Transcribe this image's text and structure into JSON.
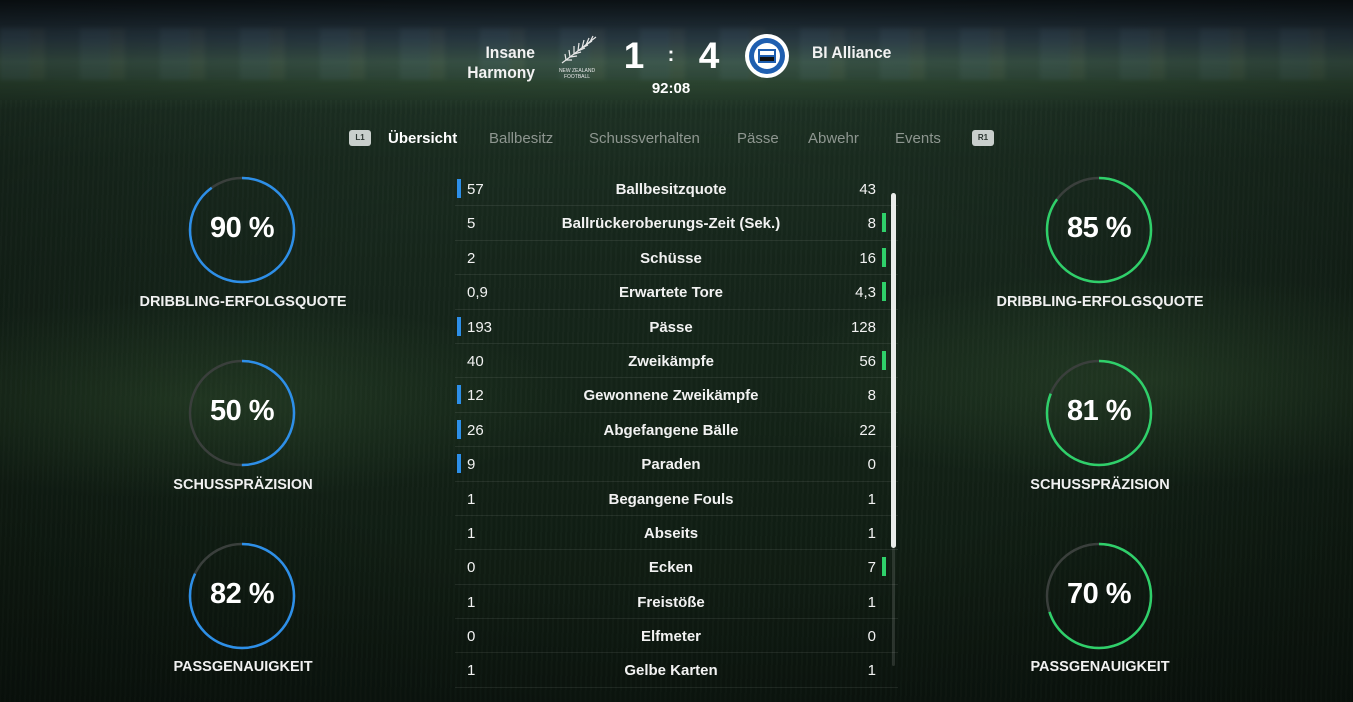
{
  "match": {
    "home_team": "Insane Harmony",
    "away_team": "BI Alliance",
    "home_score": "1",
    "separator": ":",
    "away_score": "4",
    "clock": "92:08",
    "home_crest_text": "NEW ZEALAND FOOTBALL"
  },
  "tabs": {
    "left_button": "L1",
    "right_button": "R1",
    "items": [
      "Übersicht",
      "Ballbesitz",
      "Schussverhalten",
      "Pässe",
      "Abwehr",
      "Events"
    ],
    "active": "Übersicht"
  },
  "home_rings": [
    {
      "value": "90 %",
      "label": "DRIBBLING-ERFOLGSQUOTE",
      "percent": 90
    },
    {
      "value": "50 %",
      "label": "SCHUSSPRÄZISION",
      "percent": 50
    },
    {
      "value": "82 %",
      "label": "PASSGENAUIGKEIT",
      "percent": 82
    }
  ],
  "away_rings": [
    {
      "value": "85 %",
      "label": "DRIBBLING-ERFOLGSQUOTE",
      "percent": 85
    },
    {
      "value": "81 %",
      "label": "SCHUSSPRÄZISION",
      "percent": 81
    },
    {
      "value": "70 %",
      "label": "PASSGENAUIGKEIT",
      "percent": 70
    }
  ],
  "stats": [
    {
      "home": "57",
      "name": "Ballbesitzquote",
      "away": "43",
      "leader": "home"
    },
    {
      "home": "5",
      "name": "Ballrückeroberungs-Zeit (Sek.)",
      "away": "8",
      "leader": "away"
    },
    {
      "home": "2",
      "name": "Schüsse",
      "away": "16",
      "leader": "away"
    },
    {
      "home": "0,9",
      "name": "Erwartete Tore",
      "away": "4,3",
      "leader": "away"
    },
    {
      "home": "193",
      "name": "Pässe",
      "away": "128",
      "leader": "home"
    },
    {
      "home": "40",
      "name": "Zweikämpfe",
      "away": "56",
      "leader": "away"
    },
    {
      "home": "12",
      "name": "Gewonnene Zweikämpfe",
      "away": "8",
      "leader": "home"
    },
    {
      "home": "26",
      "name": "Abgefangene Bälle",
      "away": "22",
      "leader": "home"
    },
    {
      "home": "9",
      "name": "Paraden",
      "away": "0",
      "leader": "home"
    },
    {
      "home": "1",
      "name": "Begangene Fouls",
      "away": "1",
      "leader": "none"
    },
    {
      "home": "1",
      "name": "Abseits",
      "away": "1",
      "leader": "none"
    },
    {
      "home": "0",
      "name": "Ecken",
      "away": "7",
      "leader": "away"
    },
    {
      "home": "1",
      "name": "Freistöße",
      "away": "1",
      "leader": "none"
    },
    {
      "home": "0",
      "name": "Elfmeter",
      "away": "0",
      "leader": "none"
    },
    {
      "home": "1",
      "name": "Gelbe Karten",
      "away": "1",
      "leader": "none"
    }
  ],
  "colors": {
    "home_accent": "#2d8fe8",
    "away_accent": "#2fd06a",
    "ring_track": "#3a3f3c"
  }
}
